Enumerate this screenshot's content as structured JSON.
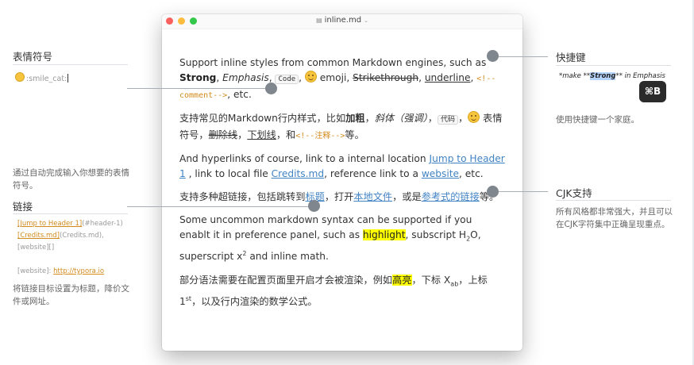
{
  "window": {
    "title": "inline.md",
    "paragraphs": {
      "p1": {
        "t1": "Support inline styles from common Markdown engines, such as ",
        "strong": "Strong",
        "t2": ", ",
        "emphasis": "Emphasis",
        "t3": ", ",
        "code": "Code",
        "t4": ", ",
        "t5": " emoji, ",
        "strike": "Strikethrough",
        "t6": ", ",
        "underline": "underline",
        "t7": ", ",
        "comment": "<!--comment-->",
        "t8": ", etc."
      },
      "p2": {
        "t1": "支持常见的Markdown行内样式，比如",
        "bold": "加粗",
        "t2": "，",
        "italic": "斜体（强调）",
        "t3": "，",
        "code": "代码",
        "t4": "，",
        "t5": " 表情符号，",
        "strike": "删除线",
        "t6": "，",
        "underline": "下划线",
        "t7": "，和",
        "comment": "<!--注释-->",
        "t8": "等。"
      },
      "p3": {
        "t1": "And hyperlinks of course, link to a internal location ",
        "link1": "Jump to Header 1",
        "t2": " , link to local file ",
        "link2": "Credits.md",
        "t3": ", reference link to a ",
        "link3": "website",
        "t4": ", etc."
      },
      "p4": {
        "t1": "支持多种超链接，包括跳转到",
        "link1": "标题",
        "t2": "，打开",
        "link2": "本地文件",
        "t3": "，或是",
        "link3": "参考式的链接",
        "t4": "等。"
      },
      "p5": {
        "t1": "Some uncommon markdown syntax can be supported if you enablt it in preference panel, such as ",
        "highlight": "highlight",
        "t2": ", subscript H",
        "sub": "2",
        "t3": "O, superscript x",
        "sup": "2",
        "t4": " and inline math."
      },
      "p6": {
        "t1": "部分语法需要在配置页面里开启才会被渲染，例如",
        "highlight": "高亮",
        "t2": "，下标 X",
        "sub": "ab",
        "t3": "，上标 1",
        "sup": "st",
        "t4": "，以及行内渲染的数学公式。"
      }
    }
  },
  "left": {
    "emoji_title": "表情符号",
    "emoji_demo": ":smile_cat:",
    "autocomplete_text": "通过自动完成输入你想要的表情符号。",
    "links_title": "链接",
    "link_demo_1a": "[Jump to Header 1]",
    "link_demo_1b": "(#header-1)",
    "link_demo_2a": "[Credits.md]",
    "link_demo_2b": "(Credits.md),",
    "link_demo_3": "[website][]",
    "link_demo_4a": "[website]: ",
    "link_demo_4b": "http://typora.io",
    "links_text": "将链接目标设置为标题，降价文件或网址。"
  },
  "right": {
    "shortcut_title": "快捷键",
    "shortcut_demo_a": "*make **",
    "shortcut_demo_sel": "Strong",
    "shortcut_demo_b": "** in Emphasis",
    "shortcut_key": "⌘B",
    "shortcut_text": "使用快捷键一个家庭。",
    "cjk_title": "CJK支持",
    "cjk_text": "所有风格都非常强大，并且可以在CJK字符集中正确呈现重点。"
  },
  "colors": {
    "link": "#4183c4",
    "comment": "#d38a1e",
    "highlight": "#ffff00",
    "dot": "#80868d"
  }
}
